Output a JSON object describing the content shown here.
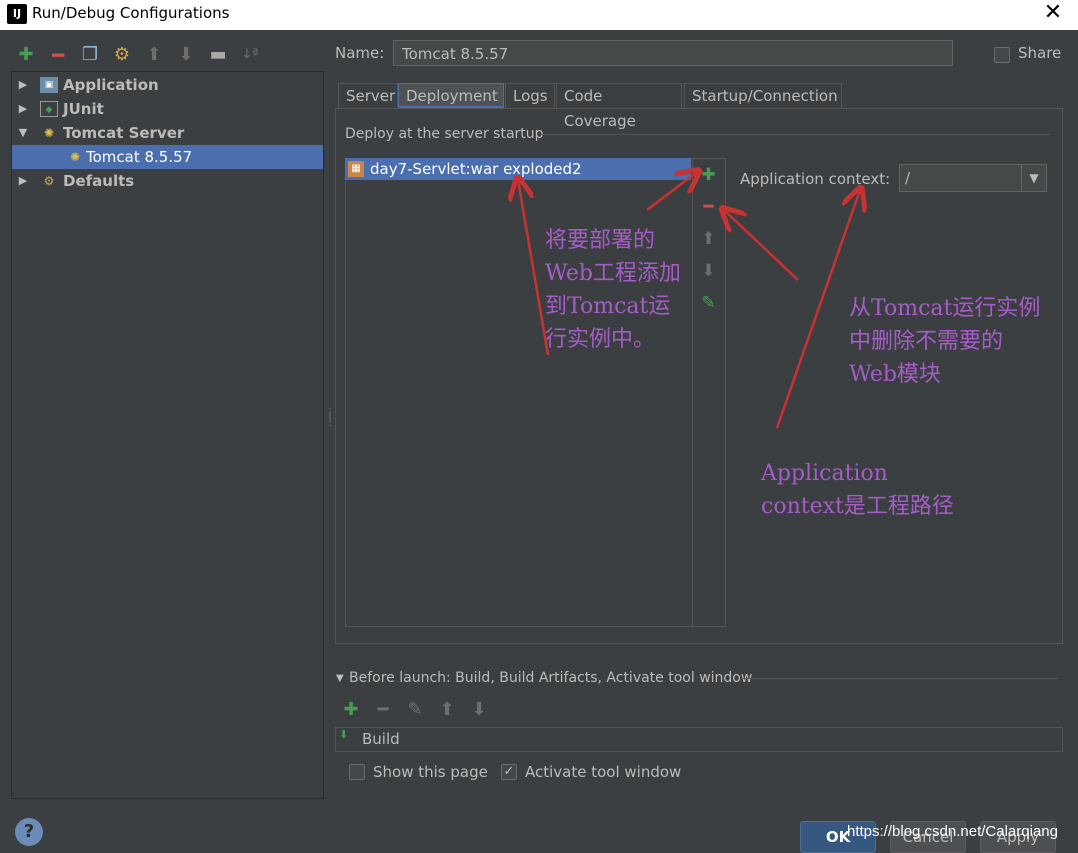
{
  "window": {
    "title": "Run/Debug Configurations",
    "app_icon": "IJ"
  },
  "toolbar": {
    "icons": [
      "add-icon",
      "remove-icon",
      "copy-icon",
      "wrench-icon",
      "arrow-up-icon",
      "arrow-down-icon",
      "folder-icon",
      "sort-icon"
    ]
  },
  "tree": {
    "items": [
      {
        "label": "Application",
        "icon": "application-icon",
        "expanded": false
      },
      {
        "label": "JUnit",
        "icon": "junit-icon",
        "expanded": false
      },
      {
        "label": "Tomcat Server",
        "icon": "tomcat-icon",
        "expanded": true
      },
      {
        "label": "Tomcat 8.5.57",
        "icon": "tomcat-icon",
        "selected": true
      },
      {
        "label": "Defaults",
        "icon": "wrench-icon",
        "expanded": false
      }
    ]
  },
  "name_field": {
    "label": "Name:",
    "value": "Tomcat 8.5.57"
  },
  "share": {
    "label": "Share",
    "checked": false
  },
  "tabs": [
    {
      "label": "Server"
    },
    {
      "label": "Deployment",
      "active": true
    },
    {
      "label": "Logs"
    },
    {
      "label": "Code Coverage"
    },
    {
      "label": "Startup/Connection"
    }
  ],
  "deployment": {
    "section_label": "Deploy at the server startup",
    "artifacts": [
      {
        "label": "day7-Servlet:war exploded2"
      }
    ],
    "app_context_label": "Application context:",
    "app_context_value": "/"
  },
  "before_launch": {
    "label": "Before launch: Build, Build Artifacts, Activate tool window",
    "items": [
      {
        "label": "Build"
      }
    ]
  },
  "options": {
    "show_page": {
      "label": "Show this page",
      "checked": false
    },
    "activate_tool": {
      "label": "Activate tool window",
      "checked": true
    }
  },
  "buttons": {
    "ok": "OK",
    "cancel": "Cancel",
    "apply": "Apply",
    "help": "?"
  },
  "annotations": {
    "add_line1": "将要部署的",
    "add_line2": "Web工程添加",
    "add_line3": "到Tomcat运",
    "add_line4": "行实例中。",
    "remove_line1": "从Tomcat运行实例",
    "remove_line2": "中删除不需要的",
    "remove_line3": "Web模块",
    "context_line1": "Application",
    "context_line2": "context是工程路径"
  },
  "watermark": "https://blog.csdn.net/Calarqiang",
  "colors": {
    "background": "#3c3f41",
    "selection": "#4b6eaf",
    "annotation": "#a55cc9",
    "arrow": "#c83232"
  }
}
